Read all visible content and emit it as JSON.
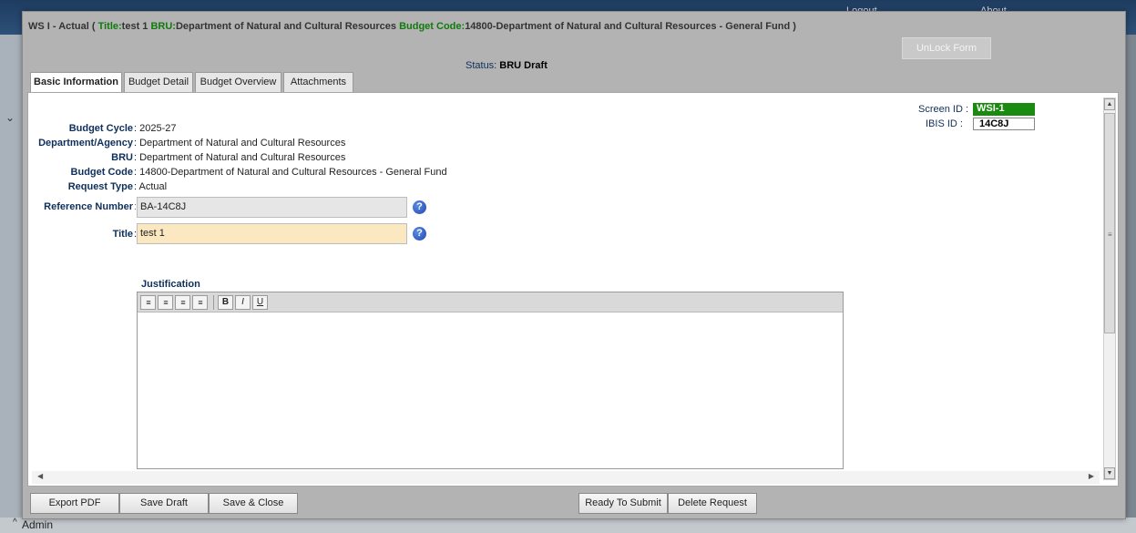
{
  "background": {
    "top_links": [
      "Logout",
      "About"
    ],
    "user_label": "Admin"
  },
  "dialog": {
    "title_prefix": "WS I - Actual ( ",
    "title_label": "Title:",
    "title_value": "test 1 ",
    "bru_label": "BRU:",
    "bru_value": "Department of Natural and Cultural Resources ",
    "budget_code_label": "Budget Code:",
    "budget_code_value": "14800-Department of Natural and Cultural Resources - General Fund )",
    "unlock_button": "UnLock Form",
    "status_label": "Status: ",
    "status_value": "BRU Draft"
  },
  "tabs": [
    {
      "label": "Basic Information",
      "active": true
    },
    {
      "label": "Budget Detail",
      "active": false
    },
    {
      "label": "Budget Overview",
      "active": false
    },
    {
      "label": "Attachments",
      "active": false
    }
  ],
  "ids": {
    "screen_id_label": "Screen ID :",
    "screen_id_value": "WSI-1",
    "ibis_id_label": "IBIS ID :",
    "ibis_id_value": "14C8J"
  },
  "fields": {
    "budget_cycle": {
      "label": "Budget Cycle",
      "value": ": 2025-27"
    },
    "department": {
      "label": "Department/Agency",
      "value": ": Department of Natural and Cultural Resources"
    },
    "bru": {
      "label": "BRU",
      "value": ": Department of Natural and Cultural Resources"
    },
    "budget_code": {
      "label": "Budget Code",
      "value": ": 14800-Department of Natural and Cultural Resources - General Fund"
    },
    "request_type": {
      "label": "Request Type",
      "value": ": Actual"
    },
    "reference_number": {
      "label": "Reference Number",
      "colon": ":",
      "value": "BA-14C8J"
    },
    "title": {
      "label": "Title",
      "colon": ":",
      "value": "test 1"
    }
  },
  "justification": {
    "label": "Justification",
    "toolbar": {
      "bold": "B",
      "italic": "I",
      "underline": "U"
    },
    "content": ""
  },
  "footer": {
    "export_pdf": "Export PDF",
    "save_draft": "Save Draft",
    "save_close": "Save & Close",
    "ready_to_submit": "Ready To Submit",
    "delete_request": "Delete Request"
  },
  "colors": {
    "label_blue": "#0e2f5a",
    "green": "#117a0f",
    "title_field_bg": "#fbe8c0",
    "ref_field_bg": "#e6e6e6"
  }
}
